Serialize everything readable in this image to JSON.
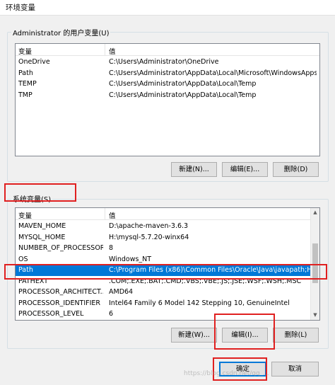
{
  "window": {
    "title": "环境变量"
  },
  "user_vars": {
    "group_label": "Administrator 的用户变量(U)",
    "columns": [
      "变量",
      "值"
    ],
    "rows": [
      {
        "name": "OneDrive",
        "value": "C:\\Users\\Administrator\\OneDrive"
      },
      {
        "name": "Path",
        "value": "C:\\Users\\Administrator\\AppData\\Local\\Microsoft\\WindowsApps;..."
      },
      {
        "name": "TEMP",
        "value": "C:\\Users\\Administrator\\AppData\\Local\\Temp"
      },
      {
        "name": "TMP",
        "value": "C:\\Users\\Administrator\\AppData\\Local\\Temp"
      }
    ],
    "buttons": {
      "new": "新建(N)...",
      "edit": "编辑(E)...",
      "delete": "删除(D)"
    }
  },
  "system_vars": {
    "group_label": "系统变量(S)",
    "columns": [
      "变量",
      "值"
    ],
    "rows": [
      {
        "name": "MAVEN_HOME",
        "value": "D:\\apache-maven-3.6.3"
      },
      {
        "name": "MYSQL_HOME",
        "value": "H:\\mysql-5.7.20-winx64"
      },
      {
        "name": "NUMBER_OF_PROCESSORS",
        "value": "8"
      },
      {
        "name": "OS",
        "value": "Windows_NT"
      },
      {
        "name": "Path",
        "value": "C:\\Program Files (x86)\\Common Files\\Oracle\\Java\\javapath;H:..."
      },
      {
        "name": "PATHEXT",
        "value": ".COM;.EXE;.BAT;.CMD;.VBS;.VBE;.JS;.JSE;.WSF;.WSH;.MSC"
      },
      {
        "name": "PROCESSOR_ARCHITECT...",
        "value": "AMD64"
      },
      {
        "name": "PROCESSOR_IDENTIFIER",
        "value": "Intel64 Family 6 Model 142 Stepping 10, GenuineIntel"
      },
      {
        "name": "PROCESSOR_LEVEL",
        "value": "6"
      }
    ],
    "selected_row": 4,
    "buttons": {
      "new": "新建(W)...",
      "edit": "编辑(I)...",
      "delete": "删除(L)"
    }
  },
  "footer": {
    "ok": "确定",
    "cancel": "取消"
  },
  "watermark": "https://blog.csdn.net/qq_..."
}
